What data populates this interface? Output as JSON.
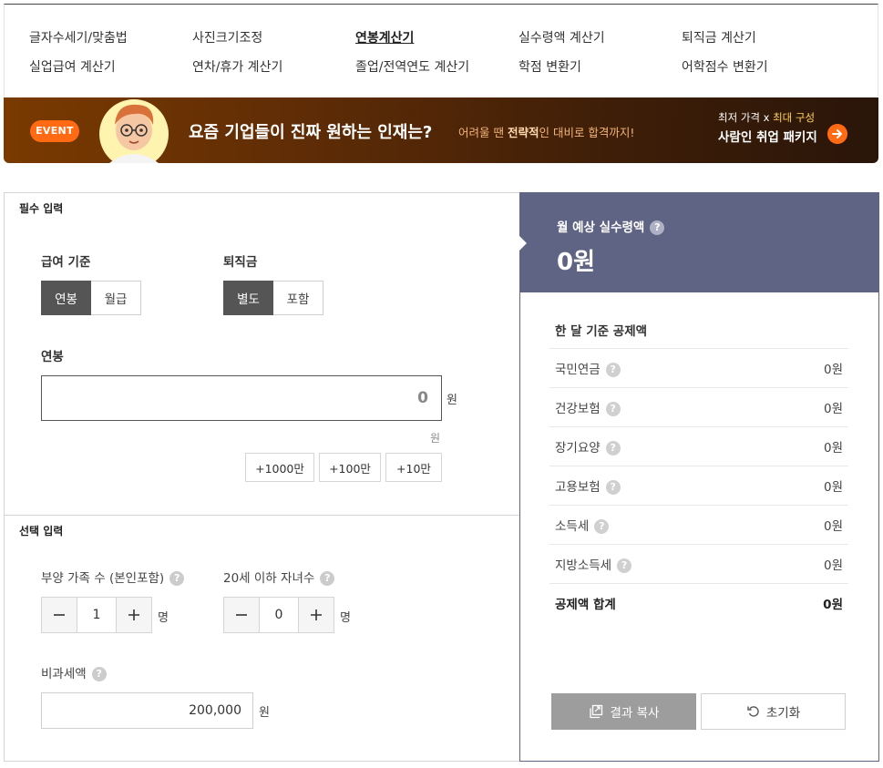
{
  "nav": {
    "items": [
      {
        "label": "글자수세기/맞춤법"
      },
      {
        "label": "사진크기조정"
      },
      {
        "label": "연봉계산기"
      },
      {
        "label": "실수령액 계산기"
      },
      {
        "label": "퇴직금 계산기"
      },
      {
        "label": "실업급여 계산기"
      },
      {
        "label": "연차/휴가 계산기"
      },
      {
        "label": "졸업/전역연도 계산기"
      },
      {
        "label": "학점 변환기"
      },
      {
        "label": "어학점수 변환기"
      }
    ],
    "active": "연봉계산기"
  },
  "banner": {
    "badge": "EVENT",
    "title": "요즘 기업들이 진짜 원하는 인재는?",
    "sub_pre": "어려울 땐 ",
    "sub_bold": "전략적",
    "sub_post": "인 대비로 합격까지!",
    "right_top_pre": "최저 가격 x ",
    "right_top_hl": "최대 구성",
    "right_bottom": "사람인 취업 패키지",
    "colors": {
      "badge": "#ff6a13",
      "accent": "#ffd35b"
    }
  },
  "required": {
    "section_title": "필수 입력",
    "salary_basis": {
      "label": "급여 기준",
      "options": [
        "연봉",
        "월급"
      ],
      "selected": "연봉"
    },
    "severance": {
      "label": "퇴직금",
      "options": [
        "별도",
        "포함"
      ],
      "selected": "별도"
    },
    "salary": {
      "label": "연봉",
      "value": "0",
      "unit": "원",
      "hint_unit": "원"
    },
    "add_buttons": [
      "+1000만",
      "+100만",
      "+10만"
    ]
  },
  "optional": {
    "section_title": "선택 입력",
    "dependents": {
      "label": "부양 가족 수 (본인포함)",
      "value": "1",
      "unit": "명"
    },
    "children": {
      "label": "20세 이하 자녀수",
      "value": "0",
      "unit": "명"
    },
    "nontax": {
      "label": "비과세액",
      "value": "200,000",
      "unit": "원"
    }
  },
  "result": {
    "head_label": "월 예상 실수령액",
    "head_value": "0원",
    "deduction_title": "한 달 기준 공제액",
    "rows": [
      {
        "label": "국민연금",
        "value": "0원"
      },
      {
        "label": "건강보험",
        "value": "0원"
      },
      {
        "label": "장기요양",
        "value": "0원"
      },
      {
        "label": "고용보험",
        "value": "0원"
      },
      {
        "label": "소득세",
        "value": "0원"
      },
      {
        "label": "지방소득세",
        "value": "0원"
      }
    ],
    "total": {
      "label": "공제액 합계",
      "value": "0원"
    },
    "copy_label": "결과 복사",
    "reset_label": "초기화",
    "colors": {
      "head_bg": "#5f6384"
    }
  }
}
